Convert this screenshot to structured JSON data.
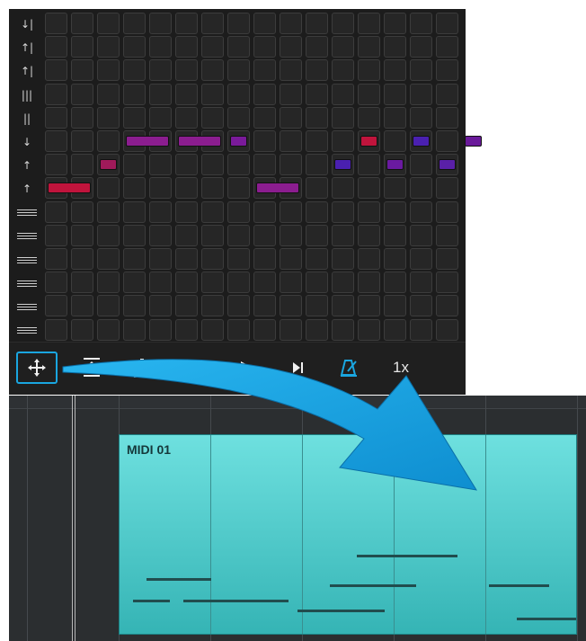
{
  "sequencer": {
    "rows": [
      {
        "icon": "down-arrow-bar-icon",
        "glyph": "↓|"
      },
      {
        "icon": "up-arrow-bar-icon",
        "glyph": "↑|"
      },
      {
        "icon": "up-arrow-bar-icon",
        "glyph": "↑|"
      },
      {
        "icon": "triple-bar-icon",
        "glyph": "|||"
      },
      {
        "icon": "double-bar-icon",
        "glyph": "||"
      },
      {
        "icon": "down-arrow-icon",
        "glyph": "↓"
      },
      {
        "icon": "up-arrow-icon",
        "glyph": "↑"
      },
      {
        "icon": "up-arrow-line-icon",
        "glyph": "↑"
      },
      {
        "icon": "staff-lines-icon",
        "glyph": ""
      },
      {
        "icon": "staff-lines-icon",
        "glyph": ""
      },
      {
        "icon": "staff-lines-icon",
        "glyph": ""
      },
      {
        "icon": "staff-lines-icon",
        "glyph": ""
      },
      {
        "icon": "staff-lines-icon",
        "glyph": ""
      },
      {
        "icon": "staff-lines-icon",
        "glyph": ""
      }
    ],
    "columns": 16,
    "notes": [
      {
        "row": 5,
        "col": 3,
        "len": 2,
        "color": "#8b1d8f"
      },
      {
        "row": 5,
        "col": 5,
        "len": 2,
        "color": "#8b1d8f"
      },
      {
        "row": 5,
        "col": 7,
        "len": 1,
        "color": "#7a1a9a"
      },
      {
        "row": 5,
        "col": 12,
        "len": 1,
        "color": "#c0143c"
      },
      {
        "row": 5,
        "col": 14,
        "len": 1,
        "color": "#4a20b0"
      },
      {
        "row": 5,
        "col": 16,
        "len": 1,
        "color": "#6a1a9a"
      },
      {
        "row": 6,
        "col": 2,
        "len": 1,
        "color": "#a01a5a"
      },
      {
        "row": 6,
        "col": 11,
        "len": 1,
        "color": "#4a20b0"
      },
      {
        "row": 6,
        "col": 13,
        "len": 1,
        "color": "#6a1aa0"
      },
      {
        "row": 6,
        "col": 15,
        "len": 1,
        "color": "#5a20a8"
      },
      {
        "row": 7,
        "col": 0,
        "len": 2,
        "color": "#c0143c"
      },
      {
        "row": 7,
        "col": 8,
        "len": 2,
        "color": "#8b1d8f"
      }
    ]
  },
  "toolbar": {
    "move": {
      "icon": "move-arrows-icon"
    },
    "upload": {
      "icon": "upload-icon"
    },
    "download": {
      "icon": "download-icon"
    },
    "skip_back": {
      "icon": "skip-back-icon"
    },
    "play": {
      "icon": "play-icon"
    },
    "skip_forward": {
      "icon": "skip-forward-icon"
    },
    "metronome": {
      "icon": "metronome-icon",
      "color": "#1aa6e0"
    },
    "speed_label": "1x"
  },
  "arrange": {
    "clip": {
      "title": "MIDI 01",
      "notes": [
        {
          "start": 0.06,
          "end": 0.2,
          "pitch": 0.72
        },
        {
          "start": 0.03,
          "end": 0.11,
          "pitch": 0.83
        },
        {
          "start": 0.14,
          "end": 0.37,
          "pitch": 0.83
        },
        {
          "start": 0.39,
          "end": 0.58,
          "pitch": 0.88
        },
        {
          "start": 0.46,
          "end": 0.65,
          "pitch": 0.75
        },
        {
          "start": 0.52,
          "end": 0.74,
          "pitch": 0.6
        },
        {
          "start": 0.81,
          "end": 0.94,
          "pitch": 0.75
        },
        {
          "start": 0.87,
          "end": 1.0,
          "pitch": 0.92
        }
      ]
    }
  },
  "colors": {
    "accent": "#1aa6e0",
    "clip_top": "#6ee0df",
    "clip_bottom": "#35b4b5",
    "arrow": "#1aa6e0"
  }
}
